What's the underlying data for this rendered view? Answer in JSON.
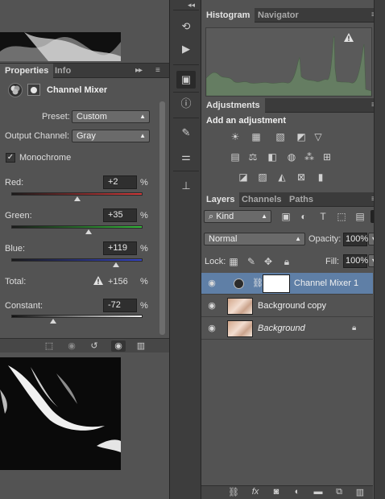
{
  "properties_panel": {
    "tabs": [
      "Properties",
      "Info"
    ],
    "adjustment_title": "Channel Mixer",
    "preset_label": "Preset:",
    "preset_value": "Custom",
    "output_channel_label": "Output Channel:",
    "output_channel_value": "Gray",
    "monochrome_label": "Monochrome",
    "monochrome_checked": true,
    "red_label": "Red:",
    "red_value": "+2",
    "red_percent": 2,
    "green_label": "Green:",
    "green_value": "+35",
    "green_percent": 35,
    "blue_label": "Blue:",
    "blue_value": "+119",
    "blue_percent": 119,
    "percent_sign": "%",
    "total_label": "Total:",
    "total_warning_icon": "warning-triangle-icon",
    "total_value": "+156",
    "constant_label": "Constant:",
    "constant_value": "-72",
    "constant_percent": -72,
    "footer_icons": [
      "clip-to-layer-icon",
      "view-previous-state-icon",
      "reset-icon",
      "visibility-icon",
      "trash-icon"
    ]
  },
  "dock": {
    "icons": [
      "history-icon",
      "actions-play-icon",
      "adjustments-icon",
      "info-icon",
      "brushes-icon",
      "brush-presets-icon",
      "clone-source-icon"
    ]
  },
  "histogram_panel": {
    "tabs": [
      "Histogram",
      "Navigator"
    ],
    "warning_icon": "warning-triangle-icon"
  },
  "adjustments_panel": {
    "tab": "Adjustments",
    "heading": "Add an adjustment",
    "icons_row1": [
      "brightness-contrast-icon",
      "levels-icon",
      "curves-icon",
      "exposure-icon",
      "vibrance-icon"
    ],
    "icons_row2": [
      "hue-saturation-icon",
      "color-balance-icon",
      "black-white-icon",
      "photo-filter-icon",
      "channel-mixer-icon",
      "color-lookup-icon"
    ],
    "icons_row3": [
      "invert-icon",
      "posterize-icon",
      "threshold-icon",
      "selective-color-icon",
      "gradient-map-icon"
    ]
  },
  "layers_panel": {
    "tabs": [
      "Layers",
      "Channels",
      "Paths"
    ],
    "filter_value": "Kind",
    "blend_mode": "Normal",
    "opacity_label": "Opacity:",
    "opacity_value": "100%",
    "lock_label": "Lock:",
    "fill_label": "Fill:",
    "fill_value": "100%",
    "layers": [
      {
        "name": "Channel Mixer 1",
        "selected": true
      },
      {
        "name": "Background copy",
        "selected": false
      },
      {
        "name": "Background",
        "selected": false
      }
    ],
    "footer_icons": [
      "link-icon",
      "fx-icon",
      "mask-icon",
      "adjustment-layer-icon",
      "group-folder-icon",
      "new-layer-icon",
      "trash-icon"
    ],
    "fx_text": "fx"
  },
  "colors": {
    "panel_bg": "#535353",
    "selection": "#5f7fa6",
    "red_track_end": "#d23a3a",
    "green_track_end": "#34b83a",
    "blue_track_end": "#3545c8"
  }
}
